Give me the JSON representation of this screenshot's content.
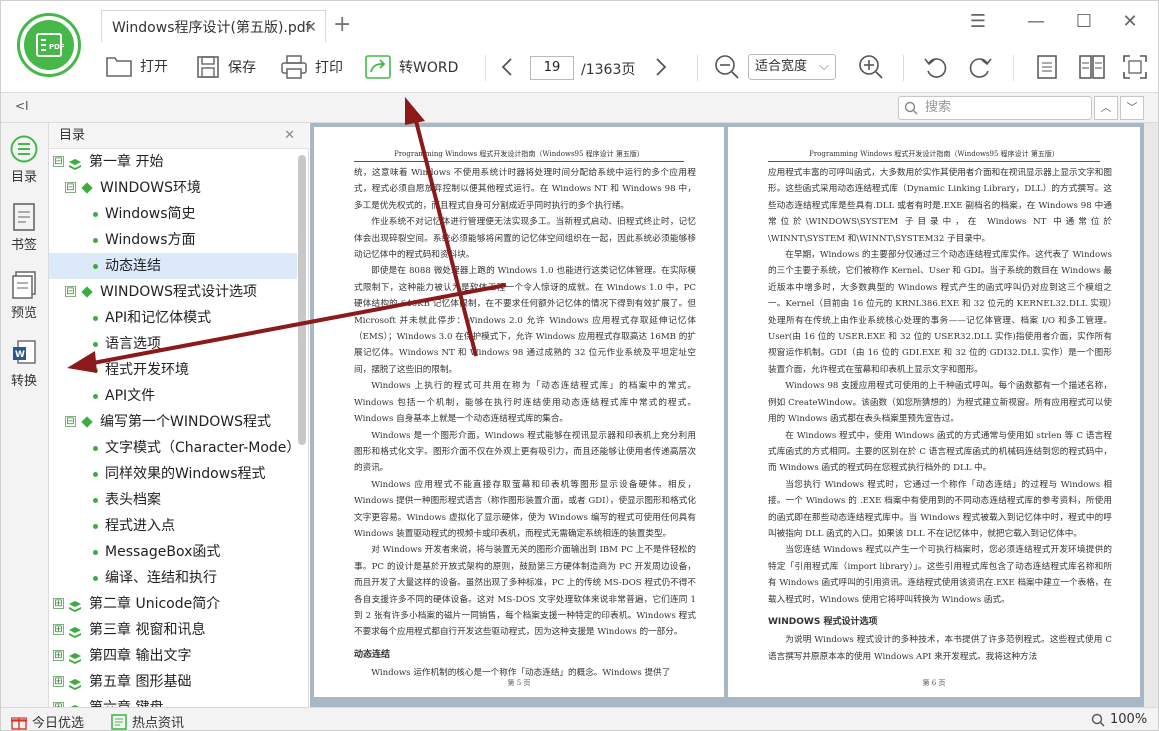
{
  "tab": {
    "title": "Windows程序设计(第五版).pdf"
  },
  "logo": {
    "text": "PDF"
  },
  "toolbar": {
    "open": "打开",
    "save": "保存",
    "print": "打印",
    "to_word": "转WORD",
    "page_current": "19",
    "page_total": "/1363页",
    "zoom_mode": "适合宽度"
  },
  "search": {
    "placeholder": "搜索"
  },
  "sidebar": {
    "toc": "目录",
    "bookmark": "书签",
    "preview": "预览",
    "convert": "转换"
  },
  "toc": {
    "title": "目录",
    "items": [
      {
        "level": 1,
        "text": "第一章 开始",
        "expand": "⊟"
      },
      {
        "level": 2,
        "text": "WINDOWS环境",
        "expand": "⊟"
      },
      {
        "level": 3,
        "text": "Windows简史"
      },
      {
        "level": 3,
        "text": "Windows方面"
      },
      {
        "level": 3,
        "text": "动态连结",
        "selected": true
      },
      {
        "level": 2,
        "text": "WINDOWS程式设计选项",
        "expand": "⊟"
      },
      {
        "level": 3,
        "text": "API和记忆体模式"
      },
      {
        "level": 3,
        "text": "语言选项"
      },
      {
        "level": 3,
        "text": "程式开发环境"
      },
      {
        "level": 3,
        "text": "API文件"
      },
      {
        "level": 2,
        "text": "编写第一个WINDOWS程式",
        "expand": "⊟"
      },
      {
        "level": 3,
        "text": "文字模式（Character-Mode）"
      },
      {
        "level": 3,
        "text": "同样效果的Windows程式"
      },
      {
        "level": 3,
        "text": "表头档案"
      },
      {
        "level": 3,
        "text": "程式进入点"
      },
      {
        "level": 3,
        "text": "MessageBox函式"
      },
      {
        "level": 3,
        "text": "编译、连结和执行"
      },
      {
        "level": 1,
        "text": "第二章 Unicode简介",
        "expand": "⊞"
      },
      {
        "level": 1,
        "text": "第三章 视窗和讯息",
        "expand": "⊞"
      },
      {
        "level": 1,
        "text": "第四章 输出文字",
        "expand": "⊞"
      },
      {
        "level": 1,
        "text": "第五章 图形基础",
        "expand": "⊞"
      },
      {
        "level": 1,
        "text": "第六章 键盘",
        "expand": "⊞"
      }
    ]
  },
  "page_left": {
    "header": "Programming Windows 程式开发设计指南（Windows95 程序设计 第五版）",
    "paragraphs": [
      {
        "indent": false,
        "text": "统，这意味着 Windows 不使用系统计时器将处理时间分配给系统中运行的多个应用程式，程式必须自愿放弃控制以便其他程式运行。在 Windows NT 和 Windows 98 中，多工是优先权式的，而且程式自身可分割成近乎同时执行的多个执行绪。"
      },
      {
        "indent": true,
        "text": "作业系统不对记忆体进行管理便无法实现多工。当新程式启动、旧程式终止时，记忆体会出现碎裂空间。系统必须能够将闲置的记忆体空间组织在一起，因此系统必须能够移动记忆体中的程式码和资料块。"
      },
      {
        "indent": true,
        "text": "即使是在 8088 微处理器上跑的 Windows 1.0 也能进行这类记忆体管理。在实际模式限制下，这种能力被认为是软体工程一个令人惊讶的成就。在 Windows 1.0 中，PC 硬体结构的 640KB 记忆体限制，在不要求任何额外记忆体的情况下得到有效扩展了。但 Microsoft 并未就此停步：Windows 2.0 允许 Windows 应用程式存取延伸记忆体（EMS）；Windows 3.0 在保护模式下，允许 Windows 应用程式存取高达 16MB 的扩展记忆体。Windows NT 和 Windows 98 通过成熟的 32 位元作业系统及平坦定址空间，摆脱了这些旧的限制。"
      },
      {
        "indent": true,
        "text": "Windows 上执行的程式可共用在称为「动态连结程式库」的档案中的常式。Windows 包括一个机制，能够在执行时连结使用动态连结程式库中常式的程式。Windows 自身基本上就是一个动态连结程式库的集合。"
      },
      {
        "indent": true,
        "text": "Windows 是一个图形介面，Windows 程式能够在视讯显示器和印表机上充分利用图形和格式化文字。图形介面不仅在外观上更有吸引力，而且还能够让使用者传递高层次的资讯。"
      },
      {
        "indent": true,
        "text": "Windows 应用程式不能直接存取萤幕和印表机等图形显示设备硬体。相反，Windows 提供一种图形程式语言（称作图形装置介面，或者 GDI），使显示图形和格式化文字更容易。Windows 虚拟化了显示硬体，使为 Windows 编写的程式可使用任何具有 Windows 装置驱动程式的视频卡或印表机，而程式无需确定系统相连的装置类型。"
      },
      {
        "indent": true,
        "text": "对 Windows 开发者来说，将与装置无关的图形介面输出到 IBM PC 上不是件轻松的事。PC 的设计是基於开放式架构的原则，鼓励第三方硬体制造商为 PC 开发周边设备，而且开发了大量这样的设备。虽然出现了多种标准，PC 上的传统 MS-DOS 程式仍不得不各自支援许多不同的硬体设备。这对 MS-DOS 文字处理软体来说非常普遍，它们连同 1 到 2 张有许多小档案的磁片一同销售，每个档案支援一种特定的印表机。Windows 程式不要求每个应用程式都自行开发这些驱动程式，因为这种支援是 Windows 的一部分。"
      }
    ],
    "heading": "动态连结",
    "last_paragraph": "Windows 运作机制的核心是一个称作「动态连结」的概念。Windows 提供了",
    "footer": "第 5 页"
  },
  "page_right": {
    "header": "Programming Windows 程式开发设计指南（Windows95 程序设计 第五版）",
    "paragraphs": [
      {
        "indent": false,
        "text": "应用程式丰富的可呼叫函式，大多数用於实作其使用者介面和在视讯显示器上显示文字和图形。这些函式采用动态连结程式库（Dynamic Linking Library，DLL）的方式撰写。这些动态连结程式库是些具有.DLL 或者有时是.EXE 副档名的档案，在 Windows 98 中通常位於\\WINDOWS\\SYSTEM 子目录中，在 Windows NT 中通常位於 \\WINNT\\SYSTEM 和\\WINNT\\SYSTEM32 子目录中。"
      },
      {
        "indent": true,
        "text": "在早期，Windows 的主要部分仅通过三个动态连结程式库实作。这代表了 Windows 的三个主要子系统，它们被称作 Kernel、User 和 GDI。当子系统的数目在 Windows 最近版本中增多时，大多数典型的 Windows 程式产生的函式呼叫仍对应到这三个模组之一。Kernel（目前由 16 位元的 KRNL386.EXE 和 32 位元的 KERNEL32.DLL 实现）处理所有在传统上由作业系统核心处理的事务——记忆体管理、档案 I/O 和多工管理。User(由 16 位的 USER.EXE 和 32 位的 USER32.DLL 实作)指使用者介面，实作所有视窗运作机制。GDI（由 16 位的 GDI.EXE 和 32 位的 GDI32.DLL 实作）是一个图形装置介面，允许程式在萤幕和印表机上显示文字和图形。"
      },
      {
        "indent": true,
        "text": "Windows 98 支援应用程式可使用的上千种函式呼叫。每个函数都有一个描述名称，例如 CreateWindow。该函数（如您所猜想的）为程式建立新视窗。所有应用程式可以使用的 Windows 函式都在表头档案里预先宣告过。"
      },
      {
        "indent": true,
        "text": "在 Windows 程式中，使用 Windows 函式的方式通常与使用如 strlen 等 C 语言程式库函式的方式相同。主要的区别在於 C 语言程式库函式的机械码连结到您的程式码中，而 Windows 函式的程式码在您程式执行档外的 DLL 中。"
      },
      {
        "indent": true,
        "text": "当您执行 Windows 程式时，它通过一个称作「动态连结」的过程与 Windows 相接。一个 Windows 的 .EXE 档案中有使用到的不同动态连结程式库的参考资料，所使用的函式即在那些动态连结程式库中。当 Windows 程式被载入到记忆体中时，程式中的呼叫被指向 DLL 函式的入口。如果该 DLL 不在记忆体中，就把它载入到记忆体中。"
      },
      {
        "indent": true,
        "text": "当您连结 Windows 程式以产生一个可执行档案时，您必须连结程式开发环境提供的特定「引用程式库（import library）」。这些引用程式库包含了动态连结程式库名称和所有 Windows 函式呼叫的引用资讯。连结程式使用该资讯在.EXE 档案中建立一个表格，在载入程式时，Windows 使用它将呼叫转换为 Windows 函式。"
      }
    ],
    "heading": "WINDOWS 程式设计选项",
    "last_paragraph": "为说明 Windows 程式设计的多种技术，本书提供了许多范例程式。这些程式使用 C 语言撰写并原原本本的使用 Windows API 来开发程式。我将这种方法",
    "footer": "第 6 页"
  },
  "status": {
    "today": "今日优选",
    "news": "热点资讯",
    "zoom": "100%"
  },
  "colors": {
    "accent_green": "#46b84a",
    "selected_row": "#dbe9f9",
    "arrow": "#8b1a1a"
  }
}
